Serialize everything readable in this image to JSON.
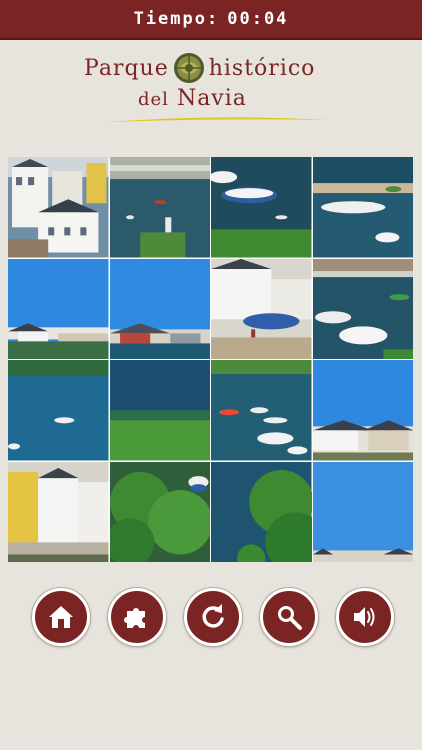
{
  "timer": {
    "label": "Tiempo:",
    "value": "00:04"
  },
  "logo": {
    "word1": "Parque",
    "word2": "histórico",
    "word3": "del",
    "word4": "Navia"
  },
  "colors": {
    "brand": "#7b2424",
    "background": "#e6e4dd",
    "swoosh": "#e6c21c"
  },
  "controls": [
    {
      "name": "home-button",
      "icon": "home-icon"
    },
    {
      "name": "puzzle-button",
      "icon": "puzzle-piece-icon"
    },
    {
      "name": "restart-button",
      "icon": "refresh-icon"
    },
    {
      "name": "zoom-button",
      "icon": "magnifier-icon"
    },
    {
      "name": "sound-button",
      "icon": "speaker-icon"
    }
  ]
}
